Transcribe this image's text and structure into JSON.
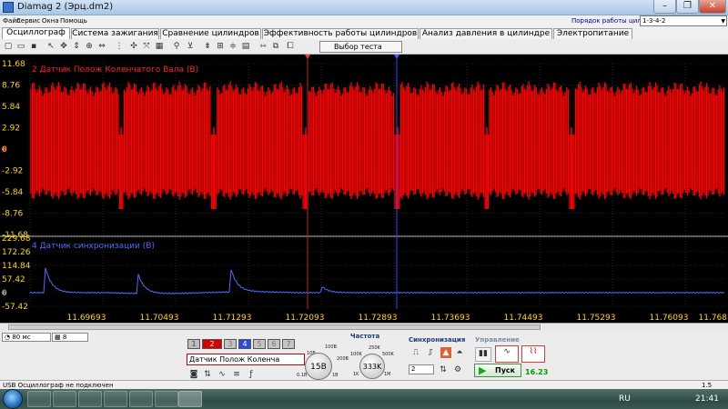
{
  "window": {
    "title": "Diamag 2 (Эрц.dm2)",
    "min": "–",
    "max": "❐",
    "close": "✕"
  },
  "menu": {
    "items": [
      "Файл",
      "Сервис",
      "Окна",
      "Помощь"
    ],
    "order_label": "Порядок работы цилиндров",
    "order_value": "1-3-4-2"
  },
  "tabs": [
    "Осциллограф",
    "Система зажигания",
    "Сравнение цилиндров",
    "Эффективность работы цилиндров",
    "Анализ давления в цилиндре",
    "Электропитание"
  ],
  "toolbar": {
    "test_select": "Выбор теста"
  },
  "chart_data": [
    {
      "type": "line",
      "title": "2 Датчик Полож Коленчатого Вала (В)",
      "color": "#ff0000",
      "y_ticks": [
        "11.68",
        "8.76",
        "5.84",
        "2.92",
        "0",
        "-2.92",
        "-5.84",
        "-8.76",
        "-11.68"
      ],
      "ylim": [
        -11.68,
        11.68
      ],
      "description_values": {
        "envelope_max": 8.76,
        "envelope_min": -5.84,
        "gap_count": 6
      }
    },
    {
      "type": "line",
      "title": "4 Датчик синхронизации (В)",
      "color": "#4a6cff",
      "y_ticks": [
        "229.68",
        "172.26",
        "114.84",
        "57.42",
        "0",
        "-57.42"
      ],
      "ylim": [
        -57.42,
        229.68
      ],
      "spikes": [
        105,
        80,
        95,
        25
      ]
    }
  ],
  "x_axis": {
    "ticks": [
      "11.69693",
      "11.70493",
      "11.71293",
      "11.72093",
      "11.72893",
      "11.73693",
      "11.74493",
      "11.75293",
      "11.76093",
      "11.768"
    ]
  },
  "controls": {
    "timebase": "80 мс",
    "division": "8",
    "channels": [
      "1",
      "2",
      "3",
      "4",
      "5",
      "6",
      "7"
    ],
    "sensor": "Датчик Полож Коленча",
    "volt_knob": "15В",
    "volt_ticks": [
      "10В",
      "100В",
      "200В",
      "0.1В",
      "1В"
    ],
    "freq_title": "Частота",
    "freq_knob": "333K",
    "freq_ticks": [
      "250K",
      "100K",
      "500K",
      "1K",
      "1M"
    ],
    "sync_title": "Синхронизация",
    "sync_value": "2",
    "mgmt_title": "Управление",
    "start_label": "Пуск",
    "fps": "16.23"
  },
  "status": {
    "text": "USB Осциллограф не подключен",
    "right": "1.5"
  },
  "taskbar": {
    "lang": "RU",
    "time": "21:41"
  }
}
